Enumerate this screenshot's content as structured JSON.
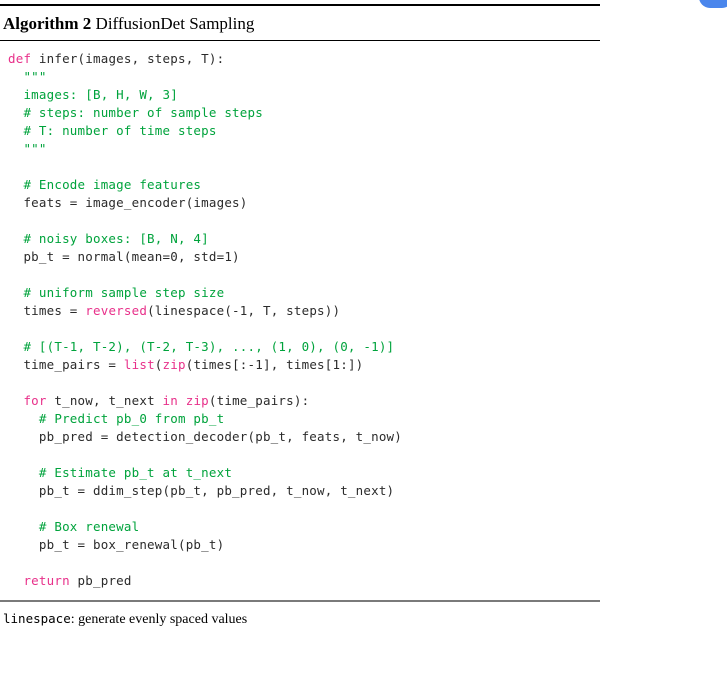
{
  "decoration": {
    "corner_blob_color": "#4a86ec",
    "name": "corner-blob"
  },
  "algorithm": {
    "label": "Algorithm 2",
    "caption": "DiffusionDet Sampling",
    "title_full": "Algorithm 2 DiffusionDet Sampling",
    "code_lines": [
      [
        {
          "t": "def",
          "c": "kw"
        },
        {
          "t": " infer(images, steps, T):",
          "c": "pl"
        }
      ],
      [
        {
          "t": "  \"\"\"",
          "c": "str"
        }
      ],
      [
        {
          "t": "  images: [B, H, W, 3]",
          "c": "str"
        }
      ],
      [
        {
          "t": "  # steps: number of sample steps",
          "c": "str"
        }
      ],
      [
        {
          "t": "  # T: number of time steps",
          "c": "str"
        }
      ],
      [
        {
          "t": "  \"\"\"",
          "c": "str"
        }
      ],
      [
        {
          "t": "",
          "c": "pl"
        }
      ],
      [
        {
          "t": "  # Encode image features",
          "c": "cm"
        }
      ],
      [
        {
          "t": "  feats = image_encoder(images)",
          "c": "pl"
        }
      ],
      [
        {
          "t": "",
          "c": "pl"
        }
      ],
      [
        {
          "t": "  # noisy boxes: [B, N, 4]",
          "c": "cm"
        }
      ],
      [
        {
          "t": "  pb_t = normal(mean=0, std=1)",
          "c": "pl"
        }
      ],
      [
        {
          "t": "",
          "c": "pl"
        }
      ],
      [
        {
          "t": "  # uniform sample step size",
          "c": "cm"
        }
      ],
      [
        {
          "t": "  times = ",
          "c": "pl"
        },
        {
          "t": "reversed",
          "c": "kw"
        },
        {
          "t": "(linespace(-1, T, steps))",
          "c": "pl"
        }
      ],
      [
        {
          "t": "",
          "c": "pl"
        }
      ],
      [
        {
          "t": "  # [(T-1, T-2), (T-2, T-3), ..., (1, 0), (0, -1)]",
          "c": "cm"
        }
      ],
      [
        {
          "t": "  time_pairs = ",
          "c": "pl"
        },
        {
          "t": "list",
          "c": "kw"
        },
        {
          "t": "(",
          "c": "pl"
        },
        {
          "t": "zip",
          "c": "kw"
        },
        {
          "t": "(times[:-1], times[1:])",
          "c": "pl"
        }
      ],
      [
        {
          "t": "",
          "c": "pl"
        }
      ],
      [
        {
          "t": "  ",
          "c": "pl"
        },
        {
          "t": "for",
          "c": "kw"
        },
        {
          "t": " t_now, t_next ",
          "c": "pl"
        },
        {
          "t": "in",
          "c": "kw"
        },
        {
          "t": " ",
          "c": "pl"
        },
        {
          "t": "zip",
          "c": "kw"
        },
        {
          "t": "(time_pairs):",
          "c": "pl"
        }
      ],
      [
        {
          "t": "    # Predict pb_0 from pb_t",
          "c": "cm"
        }
      ],
      [
        {
          "t": "    pb_pred = detection_decoder(pb_t, feats, t_now)",
          "c": "pl"
        }
      ],
      [
        {
          "t": "",
          "c": "pl"
        }
      ],
      [
        {
          "t": "    # Estimate pb_t at t_next",
          "c": "cm"
        }
      ],
      [
        {
          "t": "    pb_t = ddim_step(pb_t, pb_pred, t_now, t_next)",
          "c": "pl"
        }
      ],
      [
        {
          "t": "",
          "c": "pl"
        }
      ],
      [
        {
          "t": "    # Box renewal",
          "c": "cm"
        }
      ],
      [
        {
          "t": "    pb_t = box_renewal(pb_t)",
          "c": "pl"
        }
      ],
      [
        {
          "t": "",
          "c": "pl"
        }
      ],
      [
        {
          "t": "  ",
          "c": "pl"
        },
        {
          "t": "return",
          "c": "kw"
        },
        {
          "t": " pb_pred",
          "c": "pl"
        }
      ]
    ],
    "footnote": {
      "term": "linespace",
      "description": ": generate evenly spaced values"
    }
  },
  "colors": {
    "keyword": "#e8308a",
    "comment": "#00a33c",
    "string": "#00a33c",
    "plain": "#2b2b2b",
    "rule": "#000000",
    "rule_bottom": "#7a7a7a"
  }
}
